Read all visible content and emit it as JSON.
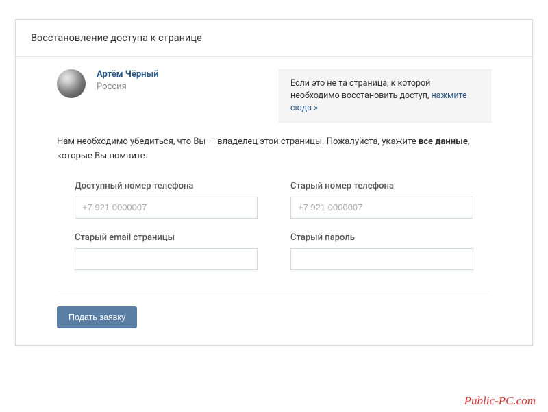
{
  "header": {
    "title": "Восстановление доступа к странице"
  },
  "profile": {
    "name": "Артём Чёрный",
    "country": "Россия"
  },
  "notice": {
    "text_prefix": "Если это не та страница, к которой необходимо восстановить доступ, ",
    "link_text": "нажмите сюда »"
  },
  "instructions": {
    "part1": "Нам необходимо убедиться, что Вы — владелец этой страницы. Пожалуйста, укажите ",
    "bold": "все данные",
    "part2": ", которые Вы помните."
  },
  "form": {
    "available_phone": {
      "label": "Доступный номер телефона",
      "placeholder": "+7 921 0000007"
    },
    "old_phone": {
      "label": "Старый номер телефона",
      "placeholder": "+7 921 0000007"
    },
    "old_email": {
      "label": "Старый email страницы",
      "placeholder": ""
    },
    "old_password": {
      "label": "Старый пароль",
      "placeholder": ""
    },
    "submit_label": "Подать заявку"
  },
  "watermark": "Public-PC.com"
}
